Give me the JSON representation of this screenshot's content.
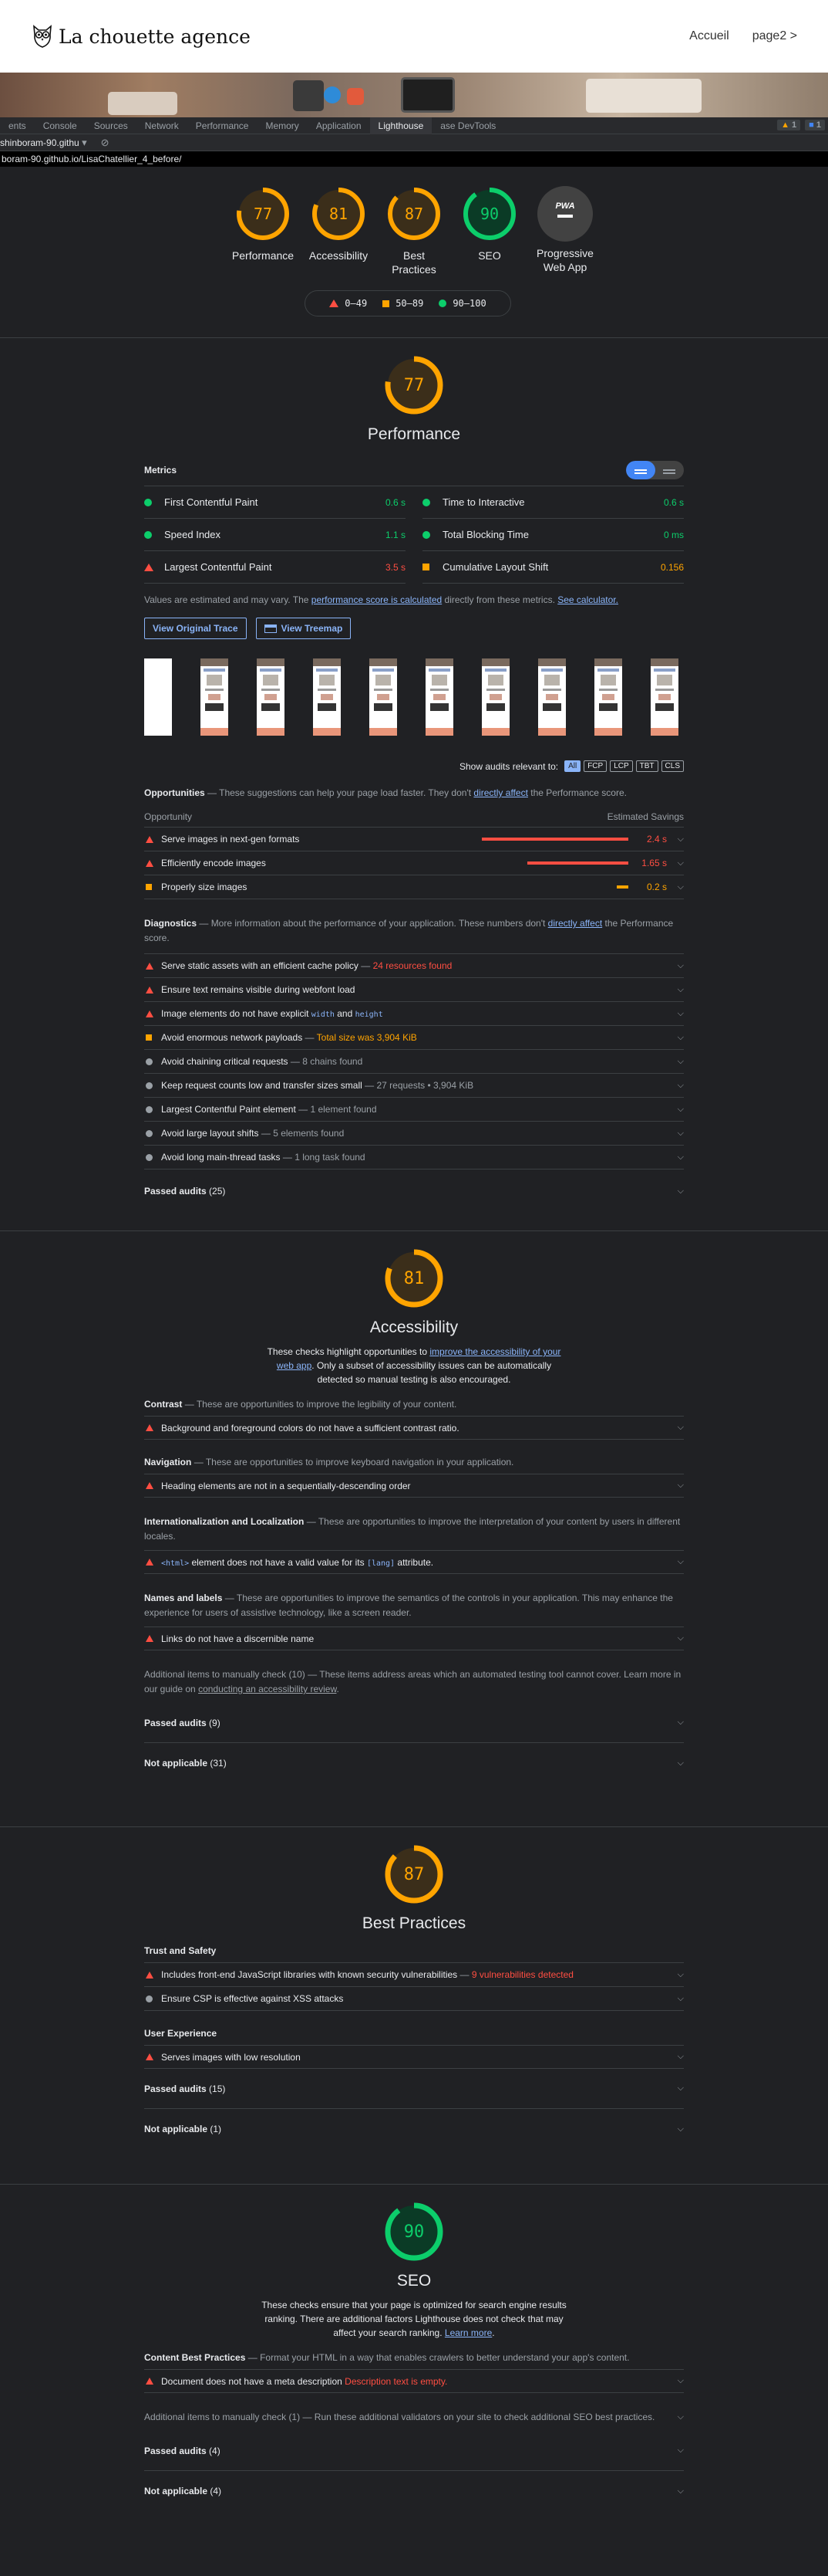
{
  "site": {
    "logo_text": "La chouette agence",
    "nav": [
      "Accueil",
      "page2 >"
    ]
  },
  "devtools": {
    "tabs": [
      "ents",
      "Console",
      "Sources",
      "Network",
      "Performance",
      "Memory",
      "Application",
      "Lighthouse",
      "ase DevTools"
    ],
    "active_tab": "Lighthouse",
    "badge_warn": "1",
    "badge_info": "1",
    "report_select": "shinboram-90.githu",
    "url": "boram-90.github.io/LisaChatellier_4_before/"
  },
  "summary": {
    "gauges": [
      {
        "label": "Performance",
        "score": 77,
        "color": "#ffa400"
      },
      {
        "label": "Accessibility",
        "score": 81,
        "color": "#ffa400"
      },
      {
        "label": "Best Practices",
        "score": 87,
        "color": "#ffa400"
      },
      {
        "label": "SEO",
        "score": 90,
        "color": "#0cce6b"
      }
    ],
    "pwa_label": "Progressive Web App",
    "pwa_badge": "PWA",
    "legend": [
      "0–49",
      "50–89",
      "90–100"
    ]
  },
  "performance": {
    "score": 77,
    "title": "Performance",
    "metrics_title": "Metrics",
    "metrics": [
      {
        "name": "First Contentful Paint",
        "value": "0.6 s",
        "status": "pass"
      },
      {
        "name": "Time to Interactive",
        "value": "0.6 s",
        "status": "pass"
      },
      {
        "name": "Speed Index",
        "value": "1.1 s",
        "status": "pass"
      },
      {
        "name": "Total Blocking Time",
        "value": "0 ms",
        "status": "pass"
      },
      {
        "name": "Largest Contentful Paint",
        "value": "3.5 s",
        "status": "fail"
      },
      {
        "name": "Cumulative Layout Shift",
        "value": "0.156",
        "status": "average"
      }
    ],
    "note_pre": "Values are estimated and may vary. The ",
    "note_link1": "performance score is calculated",
    "note_mid": " directly from these metrics. ",
    "note_link2": "See calculator.",
    "btn_trace": "View Original Trace",
    "btn_treemap": "View Treemap",
    "filter_label": "Show audits relevant to:",
    "filters": [
      "All",
      "FCP",
      "LCP",
      "TBT",
      "CLS"
    ],
    "opp_title": "Opportunities",
    "opp_desc_pre": "These suggestions can help your page load faster. They don't ",
    "opp_desc_link": "directly affect",
    "opp_desc_post": " the Performance score.",
    "opp_col1": "Opportunity",
    "opp_col2": "Estimated Savings",
    "opportunities": [
      {
        "text": "Serve images in next-gen formats",
        "saving": "2.4 s",
        "status": "fail",
        "fraction": 1.0
      },
      {
        "text": "Efficiently encode images",
        "saving": "1.65 s",
        "status": "fail",
        "fraction": 0.69
      },
      {
        "text": "Properly size images",
        "saving": "0.2 s",
        "status": "average",
        "fraction": 0.08
      }
    ],
    "diag_title": "Diagnostics",
    "diag_desc_pre": "More information about the performance of your application. These numbers don't ",
    "diag_desc_link": "directly affect",
    "diag_desc_post": " the Performance score.",
    "diagnostics": [
      {
        "text": "Serve static assets with an efficient cache policy",
        "detail": "24 resources found",
        "status": "fail"
      },
      {
        "text": "Ensure text remains visible during webfont load",
        "detail": "",
        "status": "fail"
      },
      {
        "text_pre": "Image elements do not have explicit ",
        "code1": "width",
        "text_mid": " and ",
        "code2": "height",
        "status": "fail"
      },
      {
        "text": "Avoid enormous network payloads",
        "detail": "Total size was 3,904 KiB",
        "status": "average"
      },
      {
        "text": "Avoid chaining critical requests",
        "detail": "8 chains found",
        "status": "info"
      },
      {
        "text": "Keep request counts low and transfer sizes small",
        "detail": "27 requests • 3,904 KiB",
        "status": "info"
      },
      {
        "text": "Largest Contentful Paint element",
        "detail": "1 element found",
        "status": "info"
      },
      {
        "text": "Avoid large layout shifts",
        "detail": "5 elements found",
        "status": "info"
      },
      {
        "text": "Avoid long main-thread tasks",
        "detail": "1 long task found",
        "status": "info"
      }
    ],
    "passed": "Passed audits",
    "passed_count": "(25)"
  },
  "accessibility": {
    "score": 81,
    "title": "Accessibility",
    "desc_pre": "These checks highlight opportunities to ",
    "desc_link": "improve the accessibility of your web app",
    "desc_post": ". Only a subset of accessibility issues can be automatically detected so manual testing is also encouraged.",
    "groups": [
      {
        "title": "Contrast",
        "desc": "These are opportunities to improve the legibility of your content.",
        "audit": "Background and foreground colors do not have a sufficient contrast ratio."
      },
      {
        "title": "Navigation",
        "desc": "These are opportunities to improve keyboard navigation in your application.",
        "audit": "Heading elements are not in a sequentially-descending order"
      },
      {
        "title": "Internationalization and Localization",
        "desc": "These are opportunities to improve the interpretation of your content by users in different locales.",
        "audit_code1": "<html>",
        "audit_mid": " element does not have a valid value for its ",
        "audit_code2": "[lang]",
        "audit_post": " attribute."
      },
      {
        "title": "Names and labels",
        "desc": "These are opportunities to improve the semantics of the controls in your application. This may enhance the experience for users of assistive technology, like a screen reader.",
        "audit": "Links do not have a discernible name"
      }
    ],
    "manual_title": "Additional items to manually check",
    "manual_count": "(10)",
    "manual_desc": "These items address areas which an automated testing tool cannot cover. Learn more in our guide on ",
    "manual_link": "conducting an accessibility review",
    "passed": "Passed audits",
    "passed_count": "(9)",
    "na": "Not applicable",
    "na_count": "(31)"
  },
  "best_practices": {
    "score": 87,
    "title": "Best Practices",
    "trust_title": "Trust and Safety",
    "trust_audits": [
      {
        "text": "Includes front-end JavaScript libraries with known security vulnerabilities",
        "detail": "9 vulnerabilities detected",
        "status": "fail"
      },
      {
        "text": "Ensure CSP is effective against XSS attacks",
        "detail": "",
        "status": "info"
      }
    ],
    "ux_title": "User Experience",
    "ux_audit": "Serves images with low resolution",
    "passed": "Passed audits",
    "passed_count": "(15)",
    "na": "Not applicable",
    "na_count": "(1)"
  },
  "seo": {
    "score": 90,
    "title": "SEO",
    "desc": "These checks ensure that your page is optimized for search engine results ranking. There are additional factors Lighthouse does not check that may affect your search ranking. ",
    "desc_link": "Learn more",
    "content_title": "Content Best Practices",
    "content_desc": "Format your HTML in a way that enables crawlers to better understand your app's content.",
    "audit": "Document does not have a meta description",
    "audit_detail": "Description text is empty.",
    "manual_title": "Additional items to manually check",
    "manual_count": "(1)",
    "manual_desc": "Run these additional validators on your site to check additional SEO best practices.",
    "passed": "Passed audits",
    "passed_count": "(4)",
    "na": "Not applicable",
    "na_count": "(4)"
  }
}
